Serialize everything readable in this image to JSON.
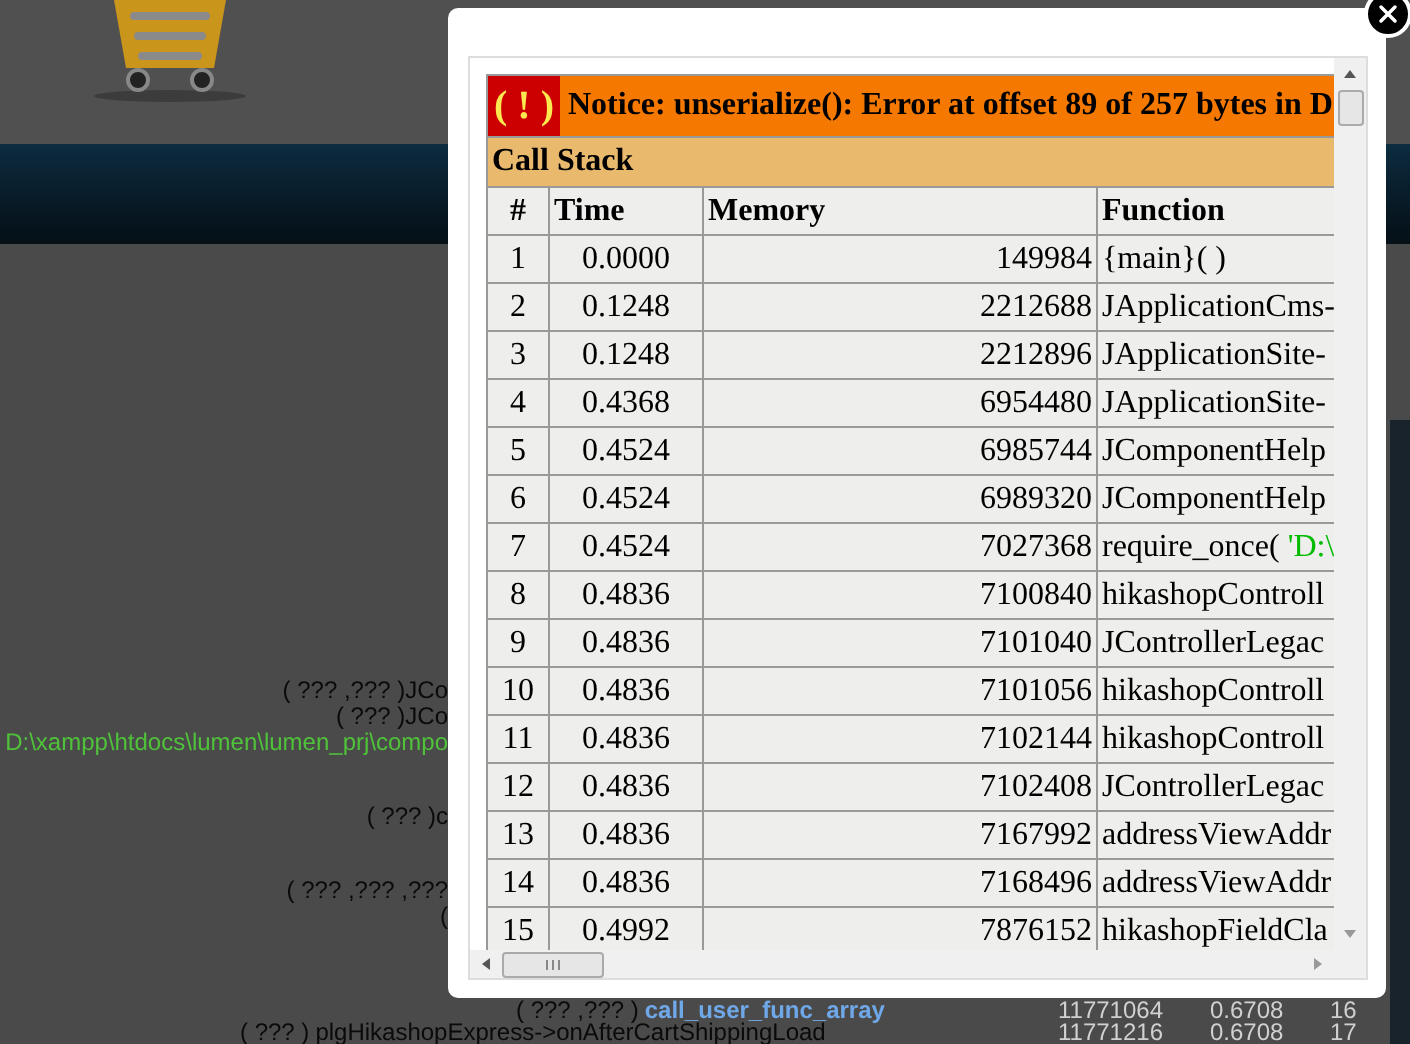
{
  "notice": {
    "icon": "( ! )",
    "message": "Notice: unserialize(): Error at offset 89 of 257 bytes in D"
  },
  "call_stack": {
    "title": "Call Stack",
    "columns": [
      "#",
      "Time",
      "Memory",
      "Function"
    ],
    "rows": [
      {
        "index": "1",
        "time": "0.0000",
        "memory": "149984",
        "function": "{main}( )"
      },
      {
        "index": "2",
        "time": "0.1248",
        "memory": "2212688",
        "function": "JApplicationCms-"
      },
      {
        "index": "3",
        "time": "0.1248",
        "memory": "2212896",
        "function": "JApplicationSite-"
      },
      {
        "index": "4",
        "time": "0.4368",
        "memory": "6954480",
        "function": "JApplicationSite-"
      },
      {
        "index": "5",
        "time": "0.4524",
        "memory": "6985744",
        "function": "JComponentHelp"
      },
      {
        "index": "6",
        "time": "0.4524",
        "memory": "6989320",
        "function": "JComponentHelp"
      },
      {
        "index": "7",
        "time": "0.4524",
        "memory": "7027368",
        "function": "require_once(",
        "argument": "'D:\\"
      },
      {
        "index": "8",
        "time": "0.4836",
        "memory": "7100840",
        "function": "hikashopControll"
      },
      {
        "index": "9",
        "time": "0.4836",
        "memory": "7101040",
        "function": "JControllerLegac"
      },
      {
        "index": "10",
        "time": "0.4836",
        "memory": "7101056",
        "function": "hikashopControll"
      },
      {
        "index": "11",
        "time": "0.4836",
        "memory": "7102144",
        "function": "hikashopControll"
      },
      {
        "index": "12",
        "time": "0.4836",
        "memory": "7102408",
        "function": "JControllerLegac"
      },
      {
        "index": "13",
        "time": "0.4836",
        "memory": "7167992",
        "function": "addressViewAddr"
      },
      {
        "index": "14",
        "time": "0.4836",
        "memory": "7168496",
        "function": "addressViewAddr"
      },
      {
        "index": "15",
        "time": "0.4992",
        "memory": "7876152",
        "function": "hikashopFieldCla"
      }
    ]
  },
  "background": {
    "lines": [
      {
        "text": "( ??? ,??? )JCo",
        "kind": "plain"
      },
      {
        "text": "( ??? )JCo",
        "kind": "plain"
      },
      {
        "text": "D:\\xampp\\htdocs\\lumen\\lumen_prj\\compo",
        "kind": "path"
      },
      {
        "text": "( ??? )c",
        "kind": "plain",
        "gap": true
      },
      {
        "text": "( ??? ,??? ,???",
        "kind": "plain",
        "gap": true
      },
      {
        "text": "(",
        "kind": "plain"
      }
    ],
    "footer_rows": [
      {
        "args": "( ??? ,??? )",
        "function": "call_user_func_array",
        "linked": true,
        "memory": "11771064",
        "time": "0.6708",
        "index": "16"
      },
      {
        "args": "( ??? )",
        "function": "plgHikashopExpress->onAfterCartShippingLoad",
        "linked": false,
        "memory": "11771216",
        "time": "0.6708",
        "index": "17"
      }
    ]
  }
}
